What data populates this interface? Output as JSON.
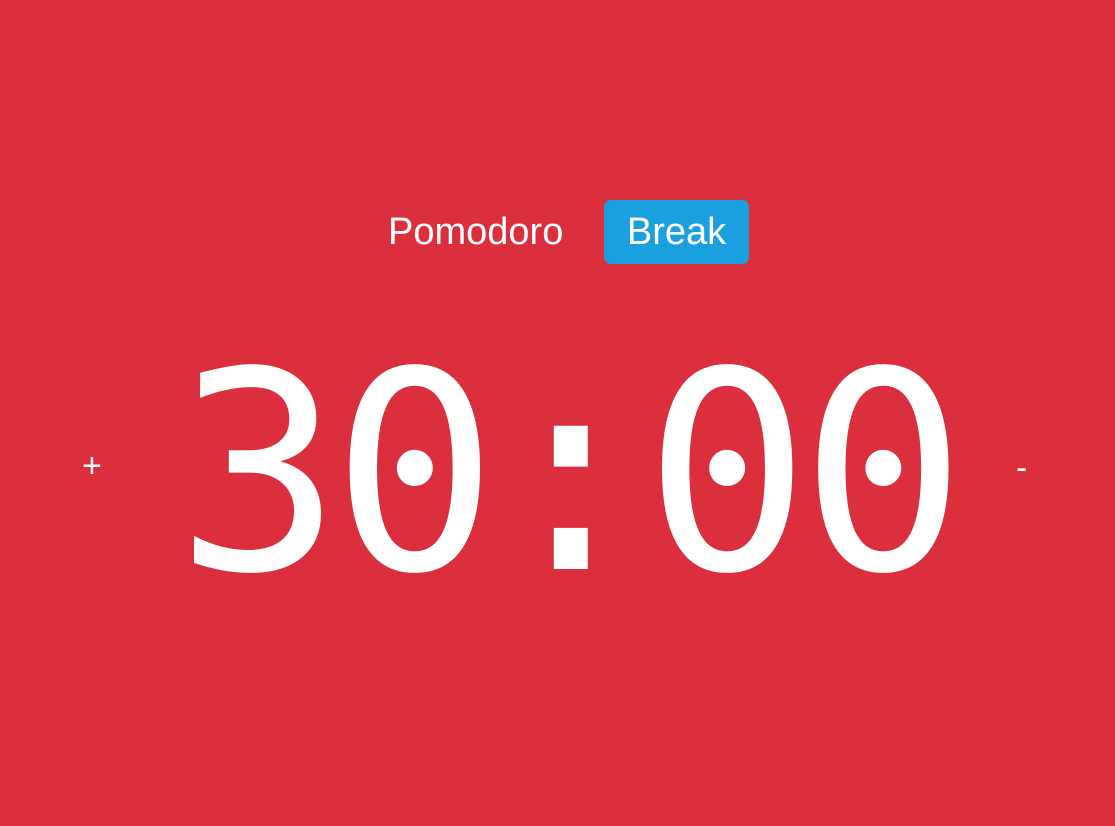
{
  "theme": {
    "background": "#dc2f3e",
    "text": "#ffffff",
    "active_tab": "#1a9fdf"
  },
  "tabs": [
    {
      "label": "Pomodoro",
      "active": false
    },
    {
      "label": "Break",
      "active": true
    }
  ],
  "timer": {
    "display": "30:00",
    "increase_label": "+",
    "decrease_label": "-"
  }
}
